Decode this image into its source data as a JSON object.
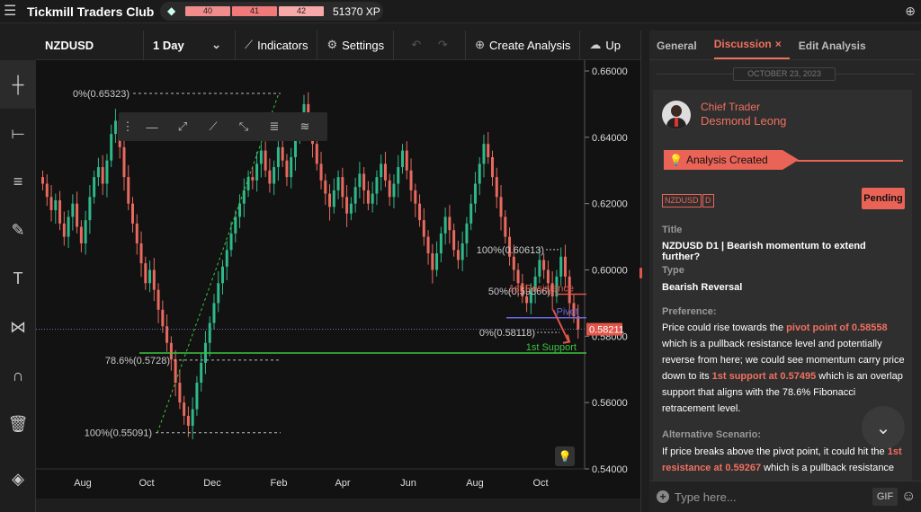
{
  "app": {
    "title": "Tickmill Traders Club",
    "menu_icon": "hamburger-icon",
    "globe_icon": "globe-icon"
  },
  "xp": {
    "levels": [
      "40",
      "41",
      "42"
    ],
    "value": "51370 XP",
    "colors": [
      "#f08c8c",
      "#f07a7a",
      "#f7a8a8"
    ]
  },
  "toolbar": {
    "symbol": "NZDUSD",
    "timeframe": "1 Day",
    "indicators": "Indicators",
    "settings": "Settings",
    "create_analysis": "Create Analysis",
    "upload_partial": "Up"
  },
  "panel": {
    "tabs": [
      {
        "label": "General"
      },
      {
        "label": "Discussion",
        "close": "×"
      },
      {
        "label": "Edit Analysis"
      }
    ],
    "date": "OCTOBER 23, 2023",
    "role": "Chief Trader",
    "author": "Desmond Leong",
    "created_label": "Analysis Created",
    "pair_tag": "NZDUSD",
    "tf_tag": "D",
    "status": "Pending",
    "title_label": "Title",
    "title_value": "NZDUSD D1 | Bearish momentum to extend further?",
    "type_label": "Type",
    "type_value": "Bearish Reversal",
    "pref_label": "Preference:",
    "pref_1": "Price could rise towards the ",
    "pref_hl1": "pivot point of 0.58558",
    "pref_2": " which is a pullback resistance level and potentially reverse from here; we could see momentum carry price down to its ",
    "pref_hl2": "1st support at 0.57495",
    "pref_3": " which is an overlap support that aligns with the 78.6% Fibonacci retracement level.",
    "alt_label": "Alternative Scenario:",
    "alt_1": "If price breaks above the pivot point, it could hit the ",
    "alt_hl1": "1st resistance at 0.59267",
    "alt_2": " which is a pullback resistance",
    "input_placeholder": "Type here...",
    "gif": "GIF"
  },
  "chart_data": {
    "type": "candlestick",
    "symbol": "NZDUSD",
    "ylim": [
      0.54,
      0.66
    ],
    "yticks": [
      "0.66000",
      "0.64000",
      "0.62000",
      "0.60000",
      "0.58000",
      "0.56000",
      "0.54000"
    ],
    "xticks": [
      "Aug",
      "Oct",
      "Dec",
      "Feb",
      "Apr",
      "Jun",
      "Aug",
      "Oct"
    ],
    "current_price": "0.58211",
    "fib_left": [
      {
        "label": "0%(0.65323)",
        "value": 0.65323
      },
      {
        "label": "78.6%(0.5728)",
        "value": 0.5728
      },
      {
        "label": "100%(0.55091)",
        "value": 0.55091
      }
    ],
    "fib_right": [
      {
        "label": "100%(0.60613)",
        "value": 0.60613
      },
      {
        "label": "50%(0.59366)",
        "value": 0.59366
      },
      {
        "label": "0%(0.58118)",
        "value": 0.58118
      }
    ],
    "levels": [
      {
        "label": "1st Resistance",
        "value": 0.59267,
        "color": "#e0554a"
      },
      {
        "label": "Pivot",
        "value": 0.58558,
        "color": "#6a6ae0"
      },
      {
        "label": "1st Support",
        "value": 0.57495,
        "color": "#3cc43c"
      }
    ],
    "closes": [
      0.626,
      0.622,
      0.618,
      0.621,
      0.614,
      0.61,
      0.616,
      0.62,
      0.613,
      0.608,
      0.615,
      0.622,
      0.628,
      0.631,
      0.626,
      0.633,
      0.641,
      0.645,
      0.637,
      0.628,
      0.62,
      0.614,
      0.608,
      0.602,
      0.596,
      0.6,
      0.594,
      0.588,
      0.583,
      0.578,
      0.573,
      0.566,
      0.56,
      0.556,
      0.553,
      0.558,
      0.566,
      0.572,
      0.578,
      0.584,
      0.59,
      0.596,
      0.601,
      0.606,
      0.611,
      0.616,
      0.62,
      0.624,
      0.628,
      0.627,
      0.632,
      0.636,
      0.63,
      0.626,
      0.631,
      0.637,
      0.633,
      0.628,
      0.634,
      0.64,
      0.645,
      0.65,
      0.644,
      0.638,
      0.632,
      0.627,
      0.623,
      0.619,
      0.624,
      0.628,
      0.622,
      0.617,
      0.62,
      0.625,
      0.629,
      0.624,
      0.62,
      0.623,
      0.628,
      0.632,
      0.627,
      0.622,
      0.626,
      0.631,
      0.636,
      0.63,
      0.624,
      0.62,
      0.615,
      0.61,
      0.605,
      0.6,
      0.605,
      0.611,
      0.616,
      0.612,
      0.606,
      0.603,
      0.608,
      0.614,
      0.62,
      0.626,
      0.632,
      0.638,
      0.634,
      0.628,
      0.622,
      0.616,
      0.61,
      0.604,
      0.6,
      0.596,
      0.592,
      0.59,
      0.594,
      0.598,
      0.603,
      0.6,
      0.596,
      0.592,
      0.598,
      0.604,
      0.598,
      0.59,
      0.586,
      0.582
    ]
  }
}
